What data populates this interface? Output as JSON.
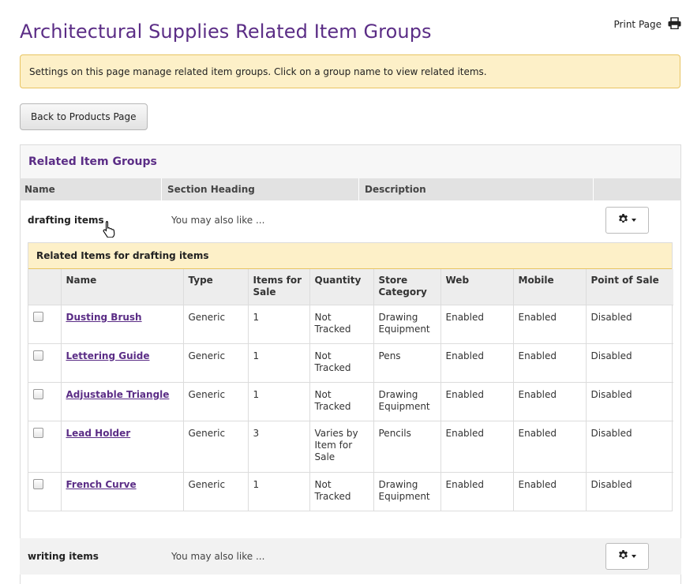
{
  "page": {
    "title": "Architectural Supplies Related Item Groups",
    "print_label": "Print Page",
    "notice": "Settings on this page manage related item groups. Click on a group name to view related items.",
    "back_button": "Back to Products Page"
  },
  "panel": {
    "title": "Related Item Groups",
    "columns": [
      "Name",
      "Section Heading",
      "Description"
    ],
    "groups": [
      {
        "name": "drafting items",
        "section_heading": "You may also like ...",
        "description": ""
      },
      {
        "name": "writing items",
        "section_heading": "You may also like ...",
        "description": ""
      }
    ]
  },
  "related": {
    "title": "Related Items for drafting items",
    "headers": [
      "Name",
      "Type",
      "Items for Sale",
      "Quantity",
      "Store Category",
      "Web",
      "Mobile",
      "Point of Sale"
    ],
    "rows": [
      {
        "name": "Dusting Brush",
        "type": "Generic",
        "items_for_sale": "1",
        "quantity": "Not Tracked",
        "category": "Drawing Equipment",
        "web": "Enabled",
        "mobile": "Enabled",
        "pos": "Disabled"
      },
      {
        "name": "Lettering Guide",
        "type": "Generic",
        "items_for_sale": "1",
        "quantity": "Not Tracked",
        "category": "Pens",
        "web": "Enabled",
        "mobile": "Enabled",
        "pos": "Disabled"
      },
      {
        "name": "Adjustable Triangle",
        "type": "Generic",
        "items_for_sale": "1",
        "quantity": "Not Tracked",
        "category": "Drawing Equipment",
        "web": "Enabled",
        "mobile": "Enabled",
        "pos": "Disabled"
      },
      {
        "name": "Lead Holder",
        "type": "Generic",
        "items_for_sale": "3",
        "quantity": "Varies by Item for Sale",
        "category": "Pencils",
        "web": "Enabled",
        "mobile": "Enabled",
        "pos": "Disabled"
      },
      {
        "name": "French Curve",
        "type": "Generic",
        "items_for_sale": "1",
        "quantity": "Not Tracked",
        "category": "Drawing Equipment",
        "web": "Enabled",
        "mobile": "Enabled",
        "pos": "Disabled"
      }
    ]
  },
  "icons": {
    "print": "printer-icon",
    "gear": "gear-icon",
    "caret": "caret-down-icon",
    "cursor": "hand-pointer-icon"
  },
  "colors": {
    "title": "#5b2d86",
    "notice_bg": "#fdf0c8",
    "notice_border": "#e8c462",
    "enabled": "#5fa024",
    "disabled": "#b03a3a"
  }
}
